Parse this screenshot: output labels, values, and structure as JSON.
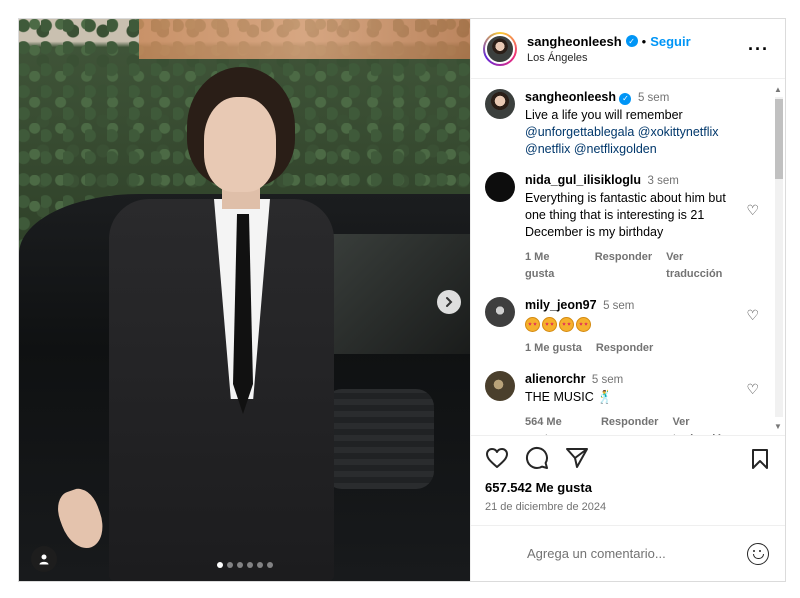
{
  "post": {
    "author": "sangheonleesh",
    "follow_label": "Seguir",
    "location": "Los Ángeles",
    "more_icon": "more-horizontal-icon",
    "caption": {
      "user": "sangheonleesh",
      "time": "5 sem",
      "text": "Live a life you will remember",
      "mentions": "@unforgettablegala @xokittynetflix @netflix @netflixgolden"
    },
    "carousel": {
      "total": 6,
      "current": 1
    },
    "likes": "657.542 Me gusta",
    "date": "21 de diciembre de 2024"
  },
  "comments": [
    {
      "user": "nida_gul_ilisikloglu",
      "time": "3 sem",
      "text": "Everything is fantastic about him but one thing that is interesting is 21 December is my birthday",
      "likes": "1 Me gusta",
      "reply": "Responder",
      "translate": "Ver traducción"
    },
    {
      "user": "mily_jeon97",
      "time": "5 sem",
      "text": "🤩🤩🤩🤩",
      "likes": "1 Me gusta",
      "reply": "Responder"
    },
    {
      "user": "alienorchr",
      "time": "5 sem",
      "text": "THE MUSIC 🕺",
      "likes": "564 Me gusta",
      "reply": "Responder",
      "translate": "Ver traducción"
    }
  ],
  "composer": {
    "placeholder": "Agrega un comentario..."
  },
  "colors": {
    "link": "#0095f6",
    "mention": "#00376b",
    "muted": "#737373"
  }
}
